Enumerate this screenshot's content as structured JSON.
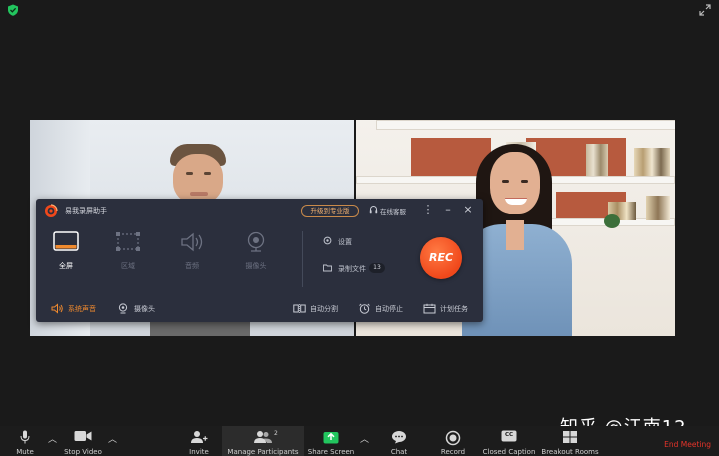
{
  "window": {
    "shield_icon": "shield-check-icon",
    "expand_icon": "fullscreen-expand-icon"
  },
  "recorder": {
    "app_name": "易我录屏助手",
    "upgrade_label": "升级到专业版",
    "support_label": "在线客服",
    "modes": [
      {
        "label": "全屏",
        "icon": "monitor-icon",
        "active": true
      },
      {
        "label": "区域",
        "icon": "region-select-icon",
        "active": false
      },
      {
        "label": "音频",
        "icon": "speaker-icon",
        "active": false
      },
      {
        "label": "摄像头",
        "icon": "webcam-icon",
        "active": false
      }
    ],
    "settings_label": "设置",
    "files_label": "录制文件",
    "files_count": "13",
    "rec_label": "REC",
    "footer": {
      "system_audio": "系统声音",
      "camera": "摄像头",
      "auto_split": "自动分割",
      "auto_stop": "自动停止",
      "schedule": "计划任务"
    },
    "colors": {
      "accent": "#f0481b",
      "panel": "#2b2f3d",
      "highlight": "#f08a2e"
    }
  },
  "watermark": "知乎 @江南12",
  "toolbar": {
    "mute": "Mute",
    "stop_video": "Stop Video",
    "invite": "Invite",
    "manage_participants": "Manage Participants",
    "participant_count": "2",
    "share_screen": "Share Screen",
    "chat": "Chat",
    "record": "Record",
    "closed_caption": "Closed Caption",
    "breakout_rooms": "Breakout Rooms",
    "end_meeting": "End Meeting",
    "cc_icon_text": "CC"
  }
}
